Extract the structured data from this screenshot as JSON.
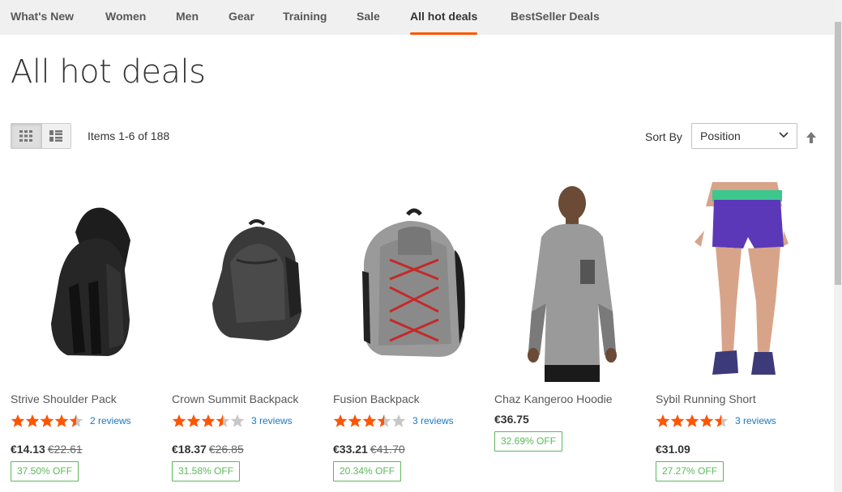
{
  "nav": {
    "items": [
      {
        "label": "What's New"
      },
      {
        "label": "Women"
      },
      {
        "label": "Men"
      },
      {
        "label": "Gear"
      },
      {
        "label": "Training"
      },
      {
        "label": "Sale"
      },
      {
        "label": "All hot deals",
        "active": true
      },
      {
        "label": "BestSeller Deals"
      }
    ]
  },
  "page": {
    "title": "All hot deals"
  },
  "toolbar": {
    "view_modes": [
      {
        "icon": "grid-icon",
        "active": true
      },
      {
        "icon": "list-icon",
        "active": false
      }
    ],
    "items_count": "Items 1-6 of 188",
    "sort_label": "Sort By",
    "sort_value": "Position",
    "sort_direction_icon": "arrow-up-icon"
  },
  "products": [
    {
      "name": "Strive Shoulder Pack",
      "rating": 4.5,
      "reviews": "2 reviews",
      "price": "€14.13",
      "old_price": "€22.61",
      "discount": "37.50% OFF",
      "image": "backpack-black-sling"
    },
    {
      "name": "Crown Summit Backpack",
      "rating": 3.5,
      "reviews": "3 reviews",
      "price": "€18.37",
      "old_price": "€26.85",
      "discount": "31.58% OFF",
      "image": "backpack-dark-grey"
    },
    {
      "name": "Fusion Backpack",
      "rating": 3.5,
      "reviews": "3 reviews",
      "price": "€33.21",
      "old_price": "€41.70",
      "discount": "20.34% OFF",
      "image": "backpack-grey-red"
    },
    {
      "name": "Chaz Kangeroo Hoodie",
      "rating": null,
      "reviews": "",
      "price": "€36.75",
      "old_price": "",
      "discount": "32.69% OFF",
      "image": "man-grey-hoodie"
    },
    {
      "name": "Sybil Running Short",
      "rating": 4.5,
      "reviews": "3 reviews",
      "price": "€31.09",
      "old_price": "",
      "discount": "27.27% OFF",
      "image": "woman-purple-shorts"
    }
  ],
  "colors": {
    "accent": "#ff5501",
    "star": "#ff5501",
    "star_empty": "#c7c7c7",
    "link": "#1979c3",
    "discount": "#5cb85c"
  }
}
